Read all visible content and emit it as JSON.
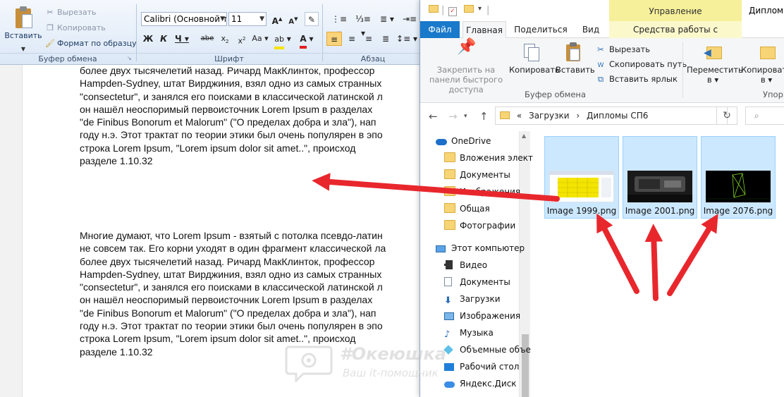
{
  "word": {
    "ribbon": {
      "clipboard": {
        "paste_label": "Вставить",
        "cut_label": "Вырезать",
        "copy_label": "Копировать",
        "format_painter_label": "Формат по образцу",
        "group_label": "Буфер обмена"
      },
      "font": {
        "font_name": "Calibri (Основной те",
        "font_size": "11",
        "group_label": "Шрифт"
      },
      "paragraph": {
        "group_label": "Абзац"
      }
    },
    "document": {
      "paragraph1": [
        "более двух тысячелетий назад. Ричард МакКлинток, профессор",
        "Hampden-Sydney, штат Вирджиния, взял одно из самых странных",
        "\"consectetur\", и занялся его поисками в классической латинской л",
        "он нашёл неоспоримый первоисточник Lorem Ipsum в разделах",
        "\"de Finibus Bonorum et Malorum\" (\"О пределах добра и зла\"), нап",
        "году н.э. Этот трактат по теории этики был очень популярен в эпо",
        "строка Lorem Ipsum, \"Lorem ipsum dolor sit amet..\", происход",
        "разделе 1.10.32"
      ],
      "paragraph2": [
        "Многие думают, что Lorem Ipsum - взятый с потолка псевдо-латин",
        "не совсем так. Его корни уходят в один фрагмент классической ла",
        "более двух тысячелетий назад. Ричард МакКлинток, профессор",
        "Hampden-Sydney, штат Вирджиния, взял одно из самых странных",
        "\"consectetur\", и занялся его поисками в классической латинской л",
        "он нашёл неоспоримый первоисточник Lorem Ipsum в разделах",
        "\"de Finibus Bonorum et Malorum\" (\"О пределах добра и зла\"), нап",
        "году н.э. Этот трактат по теории этики был очень популярен в эпо",
        "строка Lorem Ipsum, \"Lorem ipsum dolor sit amet..\", происход",
        "разделе 1.10.32"
      ]
    }
  },
  "explorer": {
    "title": "Дипломы",
    "contextual_tab": "Управление",
    "tabs": [
      "Файл",
      "Главная",
      "Поделиться",
      "Вид",
      "Средства работы с рисунками"
    ],
    "ribbon": {
      "pin_label": "Закрепить на панели быстрого доступа",
      "copy_label": "Копировать",
      "paste_label": "Вставить",
      "cut_label": "Вырезать",
      "copy_path_label": "Скопировать путь",
      "paste_shortcut_label": "Вставить ярлык",
      "group_label": "Буфер обмена",
      "move_to_label": "Переместить в",
      "copy_to_label": "Копировать в",
      "organize_label": "Упоря"
    },
    "address": {
      "prefix": "«",
      "segment1": "Загрузки",
      "separator": "›",
      "segment2": "Дипломы СП6"
    },
    "search_icon_label": "Р",
    "nav": [
      {
        "label": "OneDrive",
        "icon": "onedrive-icon"
      },
      {
        "label": "Вложения элект",
        "icon": "folder-icon"
      },
      {
        "label": "Документы",
        "icon": "folder-icon"
      },
      {
        "label": "Изображения",
        "icon": "folder-icon"
      },
      {
        "label": "Общая",
        "icon": "folder-icon"
      },
      {
        "label": "Фотографии",
        "icon": "folder-icon"
      },
      {
        "label": "Этот компьютер",
        "icon": "computer-icon"
      },
      {
        "label": "Видео",
        "icon": "video-icon"
      },
      {
        "label": "Документы",
        "icon": "documents-icon"
      },
      {
        "label": "Загрузки",
        "icon": "downloads-icon"
      },
      {
        "label": "Изображения",
        "icon": "pictures-icon"
      },
      {
        "label": "Музыка",
        "icon": "music-icon"
      },
      {
        "label": "Объемные объе",
        "icon": "3d-objects-icon"
      },
      {
        "label": "Рабочий стол",
        "icon": "desktop-icon"
      },
      {
        "label": "Яндекс.Диск",
        "icon": "yandex-disk-icon"
      }
    ],
    "files": [
      {
        "name": "Image 1999.png"
      },
      {
        "name": "Image 2001.png"
      },
      {
        "name": "Image 2076.png"
      }
    ]
  },
  "watermark": {
    "brand": "#Океюшка",
    "tagline": "Ваш it-помощник"
  },
  "colors": {
    "arrow": "#e8272d",
    "selection": "#cce8ff",
    "file_tab": "#1979ca",
    "manage_tab": "#f6f09a"
  }
}
